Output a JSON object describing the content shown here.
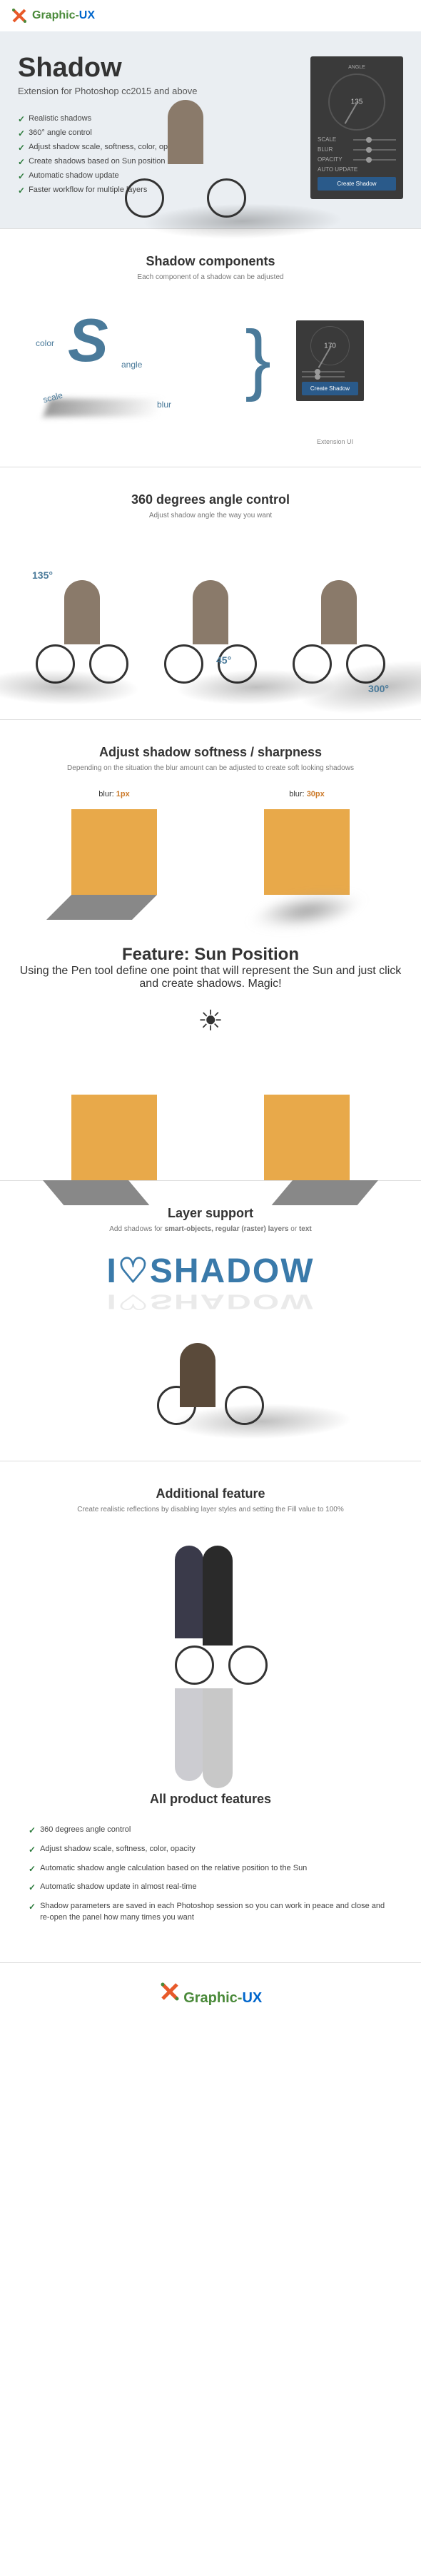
{
  "logo": {
    "graphic": "Graphic-",
    "ux": "UX"
  },
  "hero": {
    "title": "Shadow",
    "subtitle": "Extension for Photoshop cc2015 and above",
    "features": [
      "Realistic shadows",
      "360° angle control",
      "Adjust shadow scale, softness, color, opacity",
      "Create shadows based on Sun position",
      "Automatic shadow update",
      "Faster workflow for multiple layers"
    ]
  },
  "panel": {
    "header": "ANGLE",
    "dial_value": "135",
    "scale_label": "SCALE",
    "blur_label": "BLUR",
    "opacity_label": "OPACITY",
    "auto_label": "AUTO UPDATE",
    "button": "Create Shadow"
  },
  "components": {
    "title": "Shadow components",
    "desc": "Each component of a shadow can be adjusted",
    "color": "color",
    "angle": "angle",
    "scale": "scale",
    "blur": "blur",
    "ext_label": "Extension UI",
    "dial_value": "170"
  },
  "angle_section": {
    "title": "360 degrees angle control",
    "desc": "Adjust shadow angle the way you want",
    "angles": [
      "135°",
      "45°",
      "300°"
    ]
  },
  "softness": {
    "title": "Adjust shadow softness / sharpness",
    "desc": "Depending on the situation the blur amount can be adjusted to create soft looking shadows",
    "blur_label": "blur:",
    "val1": "1px",
    "val2": "30px"
  },
  "sun": {
    "title": "Feature: Sun Position",
    "desc": "Using the Pen tool define one point that will represent the Sun and just click and create shadows. Magic!"
  },
  "layer": {
    "title": "Layer support",
    "desc_pre": "Add shadows for ",
    "desc_bold": "smart-objects, regular (raster) layers",
    "desc_mid": " or ",
    "desc_bold2": "text",
    "text": "I♡SHADOW"
  },
  "additional": {
    "title": "Additional feature",
    "desc": "Create realistic reflections by disabling layer styles and setting the Fill value to 100%"
  },
  "all_features": {
    "title": "All product features",
    "items": [
      "360 degrees angle control",
      "Adjust shadow scale, softness, color, opacity",
      "Automatic shadow angle calculation based on the relative position to the Sun",
      "Automatic shadow update in almost real-time",
      "Shadow parameters are saved in each Photoshop session so you can work in peace and close and re-open the panel how many times you want"
    ]
  }
}
